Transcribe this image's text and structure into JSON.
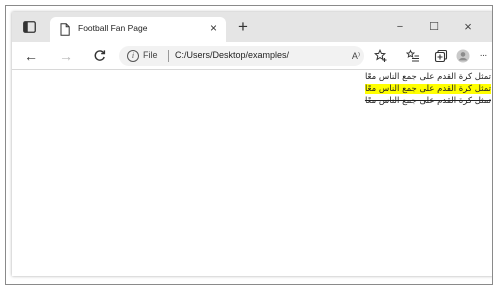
{
  "browser": {
    "tab": {
      "title": "Football Fan Page",
      "close_glyph": "×"
    },
    "new_tab_glyph": "+",
    "window_controls": {
      "minimize": "−",
      "maximize": "☐",
      "close": "×"
    },
    "toolbar": {
      "back_glyph": "←",
      "forward_glyph": "→",
      "refresh_glyph": "C",
      "site_info_glyph": "i",
      "file_label": "File",
      "url": "C:/Users/Desktop/examples/",
      "read_aloud_glyph": "A⁾",
      "more_glyph": "···"
    }
  },
  "page": {
    "lines": [
      {
        "text": "تمثل كرة القدم على جمع الناس معًا",
        "style": "normal"
      },
      {
        "text": "تمثل كرة القدم على جمع الناس معًا",
        "style": "highlight",
        "highlight_color": "#ffff00"
      },
      {
        "text": "تمثل كرة القدم على جمع الناس معًا",
        "style": "strikethrough"
      }
    ]
  }
}
